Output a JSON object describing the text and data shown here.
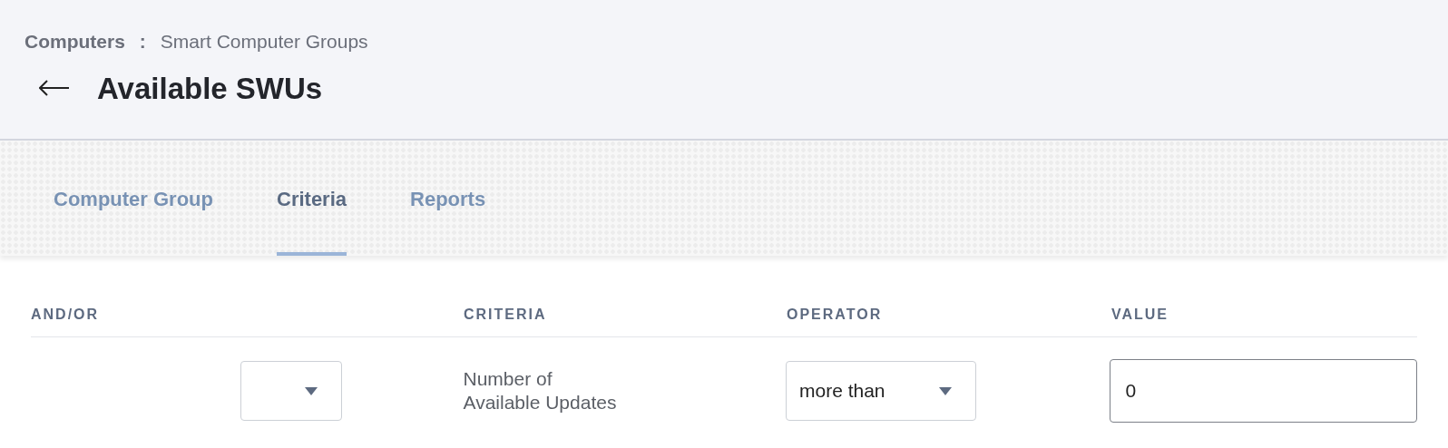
{
  "breadcrumb": {
    "section": "Computers",
    "separator": ":",
    "page": "Smart Computer Groups"
  },
  "title": "Available SWUs",
  "tabs": [
    {
      "label": "Computer Group",
      "selected": false
    },
    {
      "label": "Criteria",
      "selected": true
    },
    {
      "label": "Reports",
      "selected": false
    }
  ],
  "table": {
    "columns": [
      "AND/OR",
      "CRITERIA",
      "OPERATOR",
      "VALUE"
    ],
    "rows": [
      {
        "and_or": "",
        "criteria": "Number of\nAvailable Updates",
        "operator": "more than",
        "value": "0"
      }
    ]
  }
}
